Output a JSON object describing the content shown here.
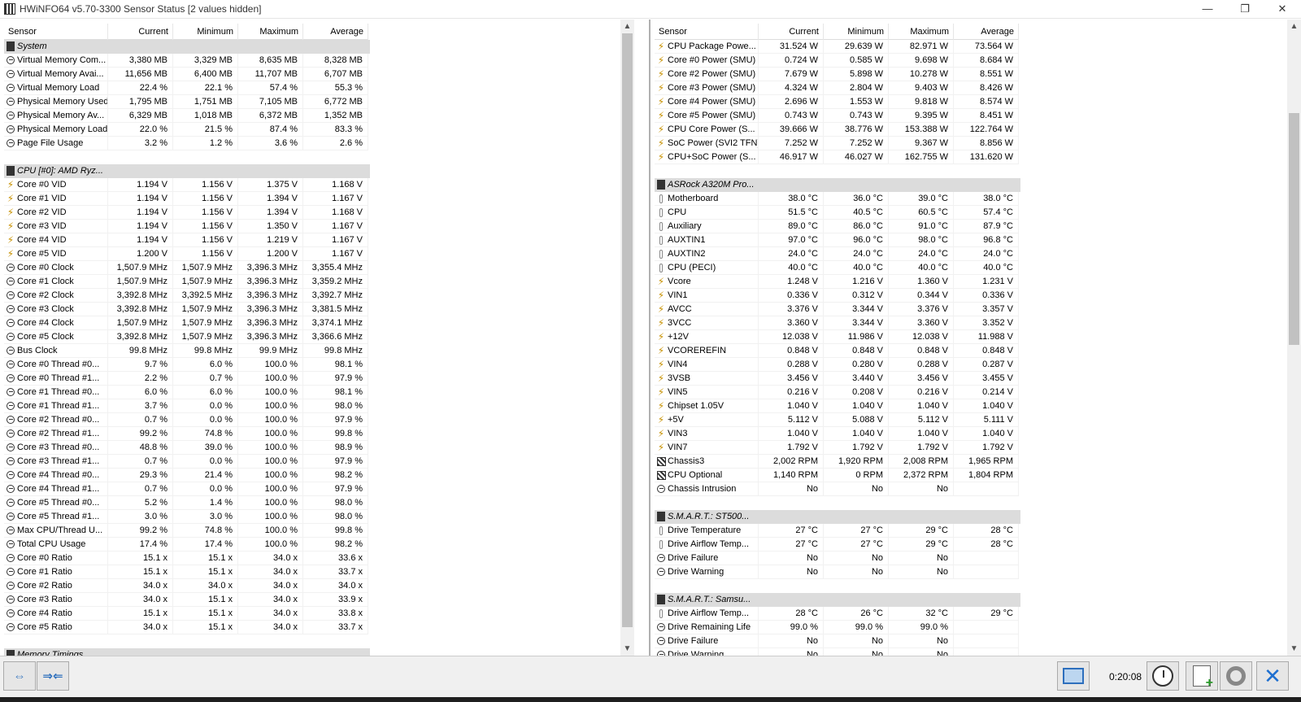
{
  "window": {
    "title": "HWiNFO64 v5.70-3300 Sensor Status [2 values hidden]",
    "minimize_glyph": "—",
    "maximize_glyph": "❐",
    "close_glyph": "✕"
  },
  "columns": {
    "sensor": "Sensor",
    "current": "Current",
    "minimum": "Minimum",
    "maximum": "Maximum",
    "average": "Average"
  },
  "left_rows": [
    {
      "type": "group",
      "icon": "chip-icon",
      "label": "System"
    },
    {
      "icon": "clock-icon",
      "label": "Virtual Memory Com...",
      "cur": "3,380 MB",
      "min": "3,329 MB",
      "max": "8,635 MB",
      "avg": "8,328 MB"
    },
    {
      "icon": "clock-icon",
      "label": "Virtual Memory Avai...",
      "cur": "11,656 MB",
      "min": "6,400 MB",
      "max": "11,707 MB",
      "avg": "6,707 MB"
    },
    {
      "icon": "clock-icon",
      "label": "Virtual Memory Load",
      "cur": "22.4 %",
      "min": "22.1 %",
      "max": "57.4 %",
      "avg": "55.3 %"
    },
    {
      "icon": "clock-icon",
      "label": "Physical Memory Used",
      "cur": "1,795 MB",
      "min": "1,751 MB",
      "max": "7,105 MB",
      "avg": "6,772 MB"
    },
    {
      "icon": "clock-icon",
      "label": "Physical Memory Av...",
      "cur": "6,329 MB",
      "min": "1,018 MB",
      "max": "6,372 MB",
      "avg": "1,352 MB"
    },
    {
      "icon": "clock-icon",
      "label": "Physical Memory Load",
      "cur": "22.0 %",
      "min": "21.5 %",
      "max": "87.4 %",
      "avg": "83.3 %"
    },
    {
      "icon": "clock-icon",
      "label": "Page File Usage",
      "cur": "3.2 %",
      "min": "1.2 %",
      "max": "3.6 %",
      "avg": "2.6 %"
    },
    {
      "type": "spacer"
    },
    {
      "type": "group",
      "icon": "chip-icon",
      "label": "CPU [#0]: AMD Ryz..."
    },
    {
      "icon": "volt-icon",
      "label": "Core #0 VID",
      "cur": "1.194 V",
      "min": "1.156 V",
      "max": "1.375 V",
      "avg": "1.168 V"
    },
    {
      "icon": "volt-icon",
      "label": "Core #1 VID",
      "cur": "1.194 V",
      "min": "1.156 V",
      "max": "1.394 V",
      "avg": "1.167 V"
    },
    {
      "icon": "volt-icon",
      "label": "Core #2 VID",
      "cur": "1.194 V",
      "min": "1.156 V",
      "max": "1.394 V",
      "avg": "1.168 V"
    },
    {
      "icon": "volt-icon",
      "label": "Core #3 VID",
      "cur": "1.194 V",
      "min": "1.156 V",
      "max": "1.350 V",
      "avg": "1.167 V"
    },
    {
      "icon": "volt-icon",
      "label": "Core #4 VID",
      "cur": "1.194 V",
      "min": "1.156 V",
      "max": "1.219 V",
      "avg": "1.167 V"
    },
    {
      "icon": "volt-icon",
      "label": "Core #5 VID",
      "cur": "1.200 V",
      "min": "1.156 V",
      "max": "1.200 V",
      "avg": "1.167 V"
    },
    {
      "icon": "clock-icon",
      "label": "Core #0 Clock",
      "cur": "1,507.9 MHz",
      "min": "1,507.9 MHz",
      "max": "3,396.3 MHz",
      "avg": "3,355.4 MHz"
    },
    {
      "icon": "clock-icon",
      "label": "Core #1 Clock",
      "cur": "1,507.9 MHz",
      "min": "1,507.9 MHz",
      "max": "3,396.3 MHz",
      "avg": "3,359.2 MHz"
    },
    {
      "icon": "clock-icon",
      "label": "Core #2 Clock",
      "cur": "3,392.8 MHz",
      "min": "3,392.5 MHz",
      "max": "3,396.3 MHz",
      "avg": "3,392.7 MHz"
    },
    {
      "icon": "clock-icon",
      "label": "Core #3 Clock",
      "cur": "3,392.8 MHz",
      "min": "1,507.9 MHz",
      "max": "3,396.3 MHz",
      "avg": "3,381.5 MHz"
    },
    {
      "icon": "clock-icon",
      "label": "Core #4 Clock",
      "cur": "1,507.9 MHz",
      "min": "1,507.9 MHz",
      "max": "3,396.3 MHz",
      "avg": "3,374.1 MHz"
    },
    {
      "icon": "clock-icon",
      "label": "Core #5 Clock",
      "cur": "3,392.8 MHz",
      "min": "1,507.9 MHz",
      "max": "3,396.3 MHz",
      "avg": "3,366.6 MHz"
    },
    {
      "icon": "clock-icon",
      "label": "Bus Clock",
      "cur": "99.8 MHz",
      "min": "99.8 MHz",
      "max": "99.9 MHz",
      "avg": "99.8 MHz"
    },
    {
      "icon": "clock-icon",
      "label": "Core #0 Thread #0...",
      "cur": "9.7 %",
      "min": "6.0 %",
      "max": "100.0 %",
      "avg": "98.1 %"
    },
    {
      "icon": "clock-icon",
      "label": "Core #0 Thread #1...",
      "cur": "2.2 %",
      "min": "0.7 %",
      "max": "100.0 %",
      "avg": "97.9 %"
    },
    {
      "icon": "clock-icon",
      "label": "Core #1 Thread #0...",
      "cur": "6.0 %",
      "min": "6.0 %",
      "max": "100.0 %",
      "avg": "98.1 %"
    },
    {
      "icon": "clock-icon",
      "label": "Core #1 Thread #1...",
      "cur": "3.7 %",
      "min": "0.0 %",
      "max": "100.0 %",
      "avg": "98.0 %"
    },
    {
      "icon": "clock-icon",
      "label": "Core #2 Thread #0...",
      "cur": "0.7 %",
      "min": "0.0 %",
      "max": "100.0 %",
      "avg": "97.9 %"
    },
    {
      "icon": "clock-icon",
      "label": "Core #2 Thread #1...",
      "cur": "99.2 %",
      "min": "74.8 %",
      "max": "100.0 %",
      "avg": "99.8 %"
    },
    {
      "icon": "clock-icon",
      "label": "Core #3 Thread #0...",
      "cur": "48.8 %",
      "min": "39.0 %",
      "max": "100.0 %",
      "avg": "98.9 %"
    },
    {
      "icon": "clock-icon",
      "label": "Core #3 Thread #1...",
      "cur": "0.7 %",
      "min": "0.0 %",
      "max": "100.0 %",
      "avg": "97.9 %"
    },
    {
      "icon": "clock-icon",
      "label": "Core #4 Thread #0...",
      "cur": "29.3 %",
      "min": "21.4 %",
      "max": "100.0 %",
      "avg": "98.2 %"
    },
    {
      "icon": "clock-icon",
      "label": "Core #4 Thread #1...",
      "cur": "0.7 %",
      "min": "0.0 %",
      "max": "100.0 %",
      "avg": "97.9 %"
    },
    {
      "icon": "clock-icon",
      "label": "Core #5 Thread #0...",
      "cur": "5.2 %",
      "min": "1.4 %",
      "max": "100.0 %",
      "avg": "98.0 %"
    },
    {
      "icon": "clock-icon",
      "label": "Core #5 Thread #1...",
      "cur": "3.0 %",
      "min": "3.0 %",
      "max": "100.0 %",
      "avg": "98.0 %"
    },
    {
      "icon": "clock-icon",
      "label": "Max CPU/Thread U...",
      "cur": "99.2 %",
      "min": "74.8 %",
      "max": "100.0 %",
      "avg": "99.8 %"
    },
    {
      "icon": "clock-icon",
      "label": "Total CPU Usage",
      "cur": "17.4 %",
      "min": "17.4 %",
      "max": "100.0 %",
      "avg": "98.2 %"
    },
    {
      "icon": "clock-icon",
      "label": "Core #0 Ratio",
      "cur": "15.1 x",
      "min": "15.1 x",
      "max": "34.0 x",
      "avg": "33.6 x"
    },
    {
      "icon": "clock-icon",
      "label": "Core #1 Ratio",
      "cur": "15.1 x",
      "min": "15.1 x",
      "max": "34.0 x",
      "avg": "33.7 x"
    },
    {
      "icon": "clock-icon",
      "label": "Core #2 Ratio",
      "cur": "34.0 x",
      "min": "34.0 x",
      "max": "34.0 x",
      "avg": "34.0 x"
    },
    {
      "icon": "clock-icon",
      "label": "Core #3 Ratio",
      "cur": "34.0 x",
      "min": "15.1 x",
      "max": "34.0 x",
      "avg": "33.9 x"
    },
    {
      "icon": "clock-icon",
      "label": "Core #4 Ratio",
      "cur": "15.1 x",
      "min": "15.1 x",
      "max": "34.0 x",
      "avg": "33.8 x"
    },
    {
      "icon": "clock-icon",
      "label": "Core #5 Ratio",
      "cur": "34.0 x",
      "min": "15.1 x",
      "max": "34.0 x",
      "avg": "33.7 x"
    },
    {
      "type": "spacer"
    },
    {
      "type": "group",
      "icon": "chip-icon",
      "label": "Memory Timings"
    }
  ],
  "right_rows": [
    {
      "icon": "volt-icon",
      "label": "CPU Package Powe...",
      "cur": "31.524 W",
      "min": "29.639 W",
      "max": "82.971 W",
      "avg": "73.564 W"
    },
    {
      "icon": "volt-icon",
      "label": "Core #0 Power (SMU)",
      "cur": "0.724 W",
      "min": "0.585 W",
      "max": "9.698 W",
      "avg": "8.684 W"
    },
    {
      "icon": "volt-icon",
      "label": "Core #2 Power (SMU)",
      "cur": "7.679 W",
      "min": "5.898 W",
      "max": "10.278 W",
      "avg": "8.551 W"
    },
    {
      "icon": "volt-icon",
      "label": "Core #3 Power (SMU)",
      "cur": "4.324 W",
      "min": "2.804 W",
      "max": "9.403 W",
      "avg": "8.426 W"
    },
    {
      "icon": "volt-icon",
      "label": "Core #4 Power (SMU)",
      "cur": "2.696 W",
      "min": "1.553 W",
      "max": "9.818 W",
      "avg": "8.574 W"
    },
    {
      "icon": "volt-icon",
      "label": "Core #5 Power (SMU)",
      "cur": "0.743 W",
      "min": "0.743 W",
      "max": "9.395 W",
      "avg": "8.451 W"
    },
    {
      "icon": "volt-icon",
      "label": "CPU Core Power (S...",
      "cur": "39.666 W",
      "min": "38.776 W",
      "max": "153.388 W",
      "avg": "122.764 W"
    },
    {
      "icon": "volt-icon",
      "label": "SoC Power (SVI2 TFN)",
      "cur": "7.252 W",
      "min": "7.252 W",
      "max": "9.367 W",
      "avg": "8.856 W"
    },
    {
      "icon": "volt-icon",
      "label": "CPU+SoC Power (S...",
      "cur": "46.917 W",
      "min": "46.027 W",
      "max": "162.755 W",
      "avg": "131.620 W"
    },
    {
      "type": "spacer"
    },
    {
      "type": "group",
      "icon": "chip-icon",
      "label": "ASRock A320M Pro..."
    },
    {
      "icon": "thermometer-icon",
      "label": "Motherboard",
      "cur": "38.0 °C",
      "min": "36.0 °C",
      "max": "39.0 °C",
      "avg": "38.0 °C"
    },
    {
      "icon": "thermometer-icon",
      "label": "CPU",
      "cur": "51.5 °C",
      "min": "40.5 °C",
      "max": "60.5 °C",
      "avg": "57.4 °C"
    },
    {
      "icon": "thermometer-icon",
      "label": "Auxiliary",
      "cur": "89.0 °C",
      "min": "86.0 °C",
      "max": "91.0 °C",
      "avg": "87.9 °C"
    },
    {
      "icon": "thermometer-icon",
      "label": "AUXTIN1",
      "cur": "97.0 °C",
      "min": "96.0 °C",
      "max": "98.0 °C",
      "avg": "96.8 °C"
    },
    {
      "icon": "thermometer-icon",
      "label": "AUXTIN2",
      "cur": "24.0 °C",
      "min": "24.0 °C",
      "max": "24.0 °C",
      "avg": "24.0 °C"
    },
    {
      "icon": "thermometer-icon",
      "label": "CPU (PECI)",
      "cur": "40.0 °C",
      "min": "40.0 °C",
      "max": "40.0 °C",
      "avg": "40.0 °C"
    },
    {
      "icon": "volt-icon",
      "label": "Vcore",
      "cur": "1.248 V",
      "min": "1.216 V",
      "max": "1.360 V",
      "avg": "1.231 V"
    },
    {
      "icon": "volt-icon",
      "label": "VIN1",
      "cur": "0.336 V",
      "min": "0.312 V",
      "max": "0.344 V",
      "avg": "0.336 V"
    },
    {
      "icon": "volt-icon",
      "label": "AVCC",
      "cur": "3.376 V",
      "min": "3.344 V",
      "max": "3.376 V",
      "avg": "3.357 V"
    },
    {
      "icon": "volt-icon",
      "label": "3VCC",
      "cur": "3.360 V",
      "min": "3.344 V",
      "max": "3.360 V",
      "avg": "3.352 V"
    },
    {
      "icon": "volt-icon",
      "label": "+12V",
      "cur": "12.038 V",
      "min": "11.986 V",
      "max": "12.038 V",
      "avg": "11.988 V"
    },
    {
      "icon": "volt-icon",
      "label": "VCOREREFIN",
      "cur": "0.848 V",
      "min": "0.848 V",
      "max": "0.848 V",
      "avg": "0.848 V"
    },
    {
      "icon": "volt-icon",
      "label": "VIN4",
      "cur": "0.288 V",
      "min": "0.280 V",
      "max": "0.288 V",
      "avg": "0.287 V"
    },
    {
      "icon": "volt-icon",
      "label": "3VSB",
      "cur": "3.456 V",
      "min": "3.440 V",
      "max": "3.456 V",
      "avg": "3.455 V"
    },
    {
      "icon": "volt-icon",
      "label": "VIN5",
      "cur": "0.216 V",
      "min": "0.208 V",
      "max": "0.216 V",
      "avg": "0.214 V"
    },
    {
      "icon": "volt-icon",
      "label": "Chipset 1.05V",
      "cur": "1.040 V",
      "min": "1.040 V",
      "max": "1.040 V",
      "avg": "1.040 V"
    },
    {
      "icon": "volt-icon",
      "label": "+5V",
      "cur": "5.112 V",
      "min": "5.088 V",
      "max": "5.112 V",
      "avg": "5.111 V"
    },
    {
      "icon": "volt-icon",
      "label": "VIN3",
      "cur": "1.040 V",
      "min": "1.040 V",
      "max": "1.040 V",
      "avg": "1.040 V"
    },
    {
      "icon": "volt-icon",
      "label": "VIN7",
      "cur": "1.792 V",
      "min": "1.792 V",
      "max": "1.792 V",
      "avg": "1.792 V"
    },
    {
      "icon": "fan-icon",
      "label": "Chassis3",
      "cur": "2,002 RPM",
      "min": "1,920 RPM",
      "max": "2,008 RPM",
      "avg": "1,965 RPM"
    },
    {
      "icon": "fan-icon",
      "label": "CPU Optional",
      "cur": "1,140 RPM",
      "min": "0 RPM",
      "max": "2,372 RPM",
      "avg": "1,804 RPM"
    },
    {
      "icon": "clock-icon",
      "label": "Chassis Intrusion",
      "cur": "No",
      "min": "No",
      "max": "No",
      "avg": ""
    },
    {
      "type": "spacer"
    },
    {
      "type": "group",
      "icon": "chip-icon",
      "label": "S.M.A.R.T.: ST500..."
    },
    {
      "icon": "thermometer-icon",
      "label": "Drive Temperature",
      "cur": "27 °C",
      "min": "27 °C",
      "max": "29 °C",
      "avg": "28 °C"
    },
    {
      "icon": "thermometer-icon",
      "label": "Drive Airflow Temp...",
      "cur": "27 °C",
      "min": "27 °C",
      "max": "29 °C",
      "avg": "28 °C"
    },
    {
      "icon": "clock-icon",
      "label": "Drive Failure",
      "cur": "No",
      "min": "No",
      "max": "No",
      "avg": ""
    },
    {
      "icon": "clock-icon",
      "label": "Drive Warning",
      "cur": "No",
      "min": "No",
      "max": "No",
      "avg": ""
    },
    {
      "type": "spacer"
    },
    {
      "type": "group",
      "icon": "chip-icon",
      "label": "S.M.A.R.T.: Samsu..."
    },
    {
      "icon": "thermometer-icon",
      "label": "Drive Airflow Temp...",
      "cur": "28 °C",
      "min": "26 °C",
      "max": "32 °C",
      "avg": "29 °C"
    },
    {
      "icon": "clock-icon",
      "label": "Drive Remaining Life",
      "cur": "99.0 %",
      "min": "99.0 %",
      "max": "99.0 %",
      "avg": ""
    },
    {
      "icon": "clock-icon",
      "label": "Drive Failure",
      "cur": "No",
      "min": "No",
      "max": "No",
      "avg": ""
    },
    {
      "icon": "clock-icon",
      "label": "Drive Warning",
      "cur": "No",
      "min": "No",
      "max": "No",
      "avg": ""
    }
  ],
  "toolbar": {
    "expand_glyph": "⇔",
    "collapse_glyph": "⇒⇐",
    "timer": "0:20:08",
    "exit_glyph": "✕"
  }
}
